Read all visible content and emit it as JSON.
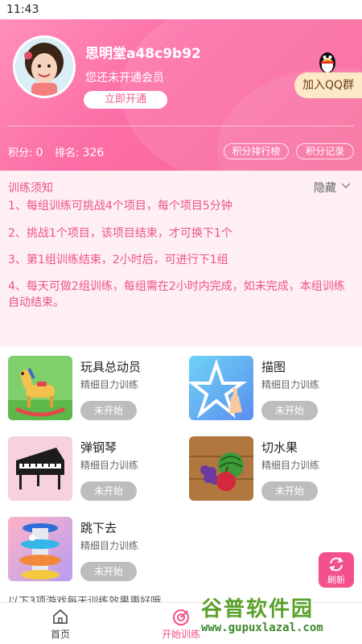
{
  "status_bar": {
    "time": "11:43"
  },
  "profile": {
    "username": "思明堂a48c9b92",
    "member_status": "您还未开通会员",
    "open_button": "立即开通",
    "qq_group_button": "加入QQ群",
    "points_label": "积分:",
    "points_value": "0",
    "rank_label": "排名:",
    "rank_value": "326",
    "leaderboard_button": "积分排行榜",
    "records_button": "积分记录"
  },
  "notice": {
    "title": "训练须知",
    "hide_label": "隐藏",
    "rules": [
      "1、每组训练可挑战4个项目，每个项目5分钟",
      "2、挑战1个项目，该项目结束，才可换下1个",
      "3、第1组训练结束，2小时后，可进行下1组",
      "4、每天可做2组训练，每组需在2小时内完成，如未完成，本组训练自动结束。"
    ]
  },
  "games": [
    {
      "name": "玩具总动员",
      "desc": "精细目力训练",
      "state": "未开始",
      "icon": "rocking-horse-icon"
    },
    {
      "name": "描图",
      "desc": "精细目力训练",
      "state": "未开始",
      "icon": "star-trace-icon"
    },
    {
      "name": "弹钢琴",
      "desc": "精细目力训练",
      "state": "未开始",
      "icon": "piano-icon"
    },
    {
      "name": "切水果",
      "desc": "精细目力训练",
      "state": "未开始",
      "icon": "fruit-icon"
    },
    {
      "name": "跳下去",
      "desc": "精细目力训练",
      "state": "未开始",
      "icon": "helix-tower-icon"
    }
  ],
  "refresh_label": "刷新",
  "hint": "以下3项游戏每天训练效果更好哦",
  "tabs": [
    {
      "label": "首页",
      "icon": "home-icon"
    },
    {
      "label": "开始训练",
      "icon": "target-icon"
    }
  ],
  "watermark": {
    "line1": "谷普软件园",
    "line2": "www.gupuxlazal.com"
  },
  "colors": {
    "brand": "#f3508c",
    "header_start": "#ff8fba",
    "header_end": "#f76196",
    "qq_button": "#fde9c8",
    "notice_bg": "#fdeff4"
  }
}
